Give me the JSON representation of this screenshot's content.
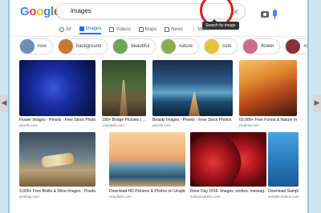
{
  "colors": {
    "g_blue": "#4285f4",
    "g_red": "#ea4335",
    "g_yellow": "#fbbc05",
    "g_green": "#34a853",
    "active_tab": "#1a73e8",
    "highlight": "#d61f1f"
  },
  "logo": [
    "G",
    "o",
    "o",
    "g",
    "l",
    "e"
  ],
  "search": {
    "value": "images",
    "clear_icon": "close-icon",
    "camera_icon": "camera-icon",
    "mic_icon": "mic-icon",
    "tooltip": "Search by image"
  },
  "tabs": [
    {
      "label": "All",
      "icon": "search-icon"
    },
    {
      "label": "Images",
      "icon": "image-icon"
    },
    {
      "label": "Videos",
      "icon": "video-icon"
    },
    {
      "label": "Maps",
      "icon": "map-icon"
    },
    {
      "label": "News",
      "icon": "news-icon"
    },
    {
      "label": "More",
      "icon": "more-icon"
    }
  ],
  "chips": [
    {
      "label": "love",
      "color": "#6e8fb3"
    },
    {
      "label": "background",
      "color": "#c9772f"
    },
    {
      "label": "beautiful",
      "color": "#6fa35a"
    },
    {
      "label": "nature",
      "color": "#8ab04e"
    },
    {
      "label": "cute",
      "color": "#e2c43c"
    },
    {
      "label": "flower",
      "color": "#d06a8e"
    },
    {
      "label": "romantic",
      "color": "#8a2e3a"
    }
  ],
  "results": [
    {
      "title": "Flower Images - Pexels - Free Stock Photos",
      "source": "pexels.com"
    },
    {
      "title": "100+ Bridge Pictures | ...",
      "source": "unsplash.com"
    },
    {
      "title": "Beauty Images - Pexels - Free Stock Photos",
      "source": "pexels.com"
    },
    {
      "title": "60,000+ Free Forest & Nature Images ...",
      "source": "pixabay.com"
    },
    {
      "title": "3,000+ Free Bottle & Wine Images - Pixabay",
      "source": "pixabay.com"
    },
    {
      "title": "Download HD Pictures & Photos on Unsplash",
      "source": "unsplash.com"
    },
    {
      "title": "Rose Day 2016: Images, wishes, messag...",
      "source": "indianexpress.com"
    },
    {
      "title": "Download Sample JPG I...",
      "source": "sample-videos.com"
    }
  ]
}
